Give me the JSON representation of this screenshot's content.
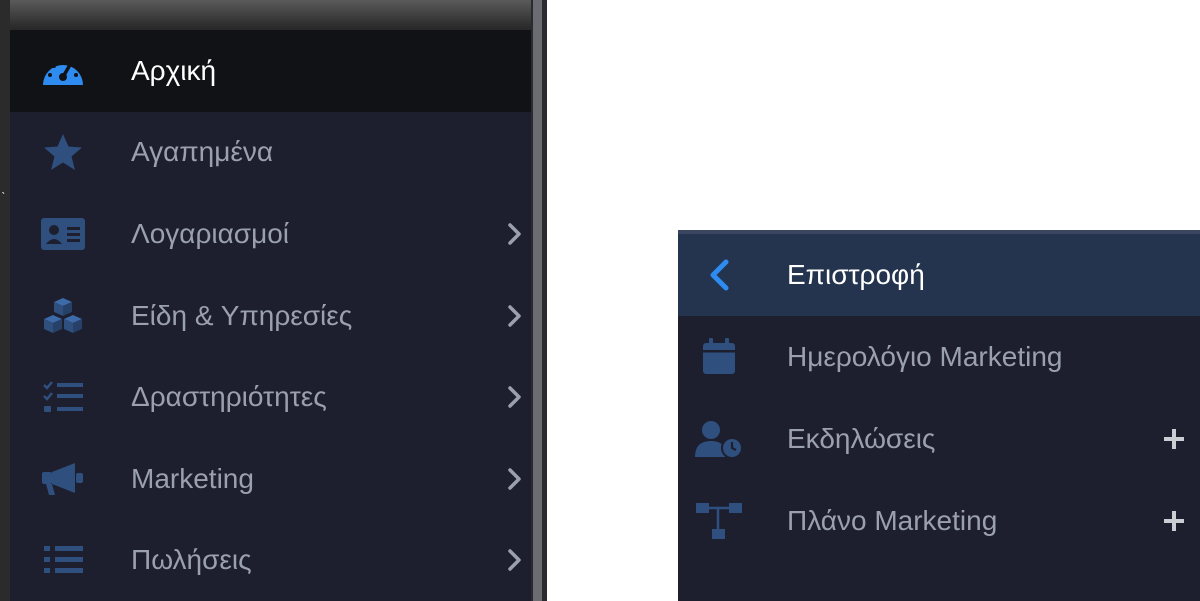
{
  "sidebar": {
    "items": [
      {
        "label": "Αρχική",
        "icon": "dashboard-gauge-icon",
        "active": true,
        "has_chevron": false
      },
      {
        "label": "Αγαπημένα",
        "icon": "star-icon",
        "active": false,
        "has_chevron": false
      },
      {
        "label": "Λογαριασμοί",
        "icon": "id-card-icon",
        "active": false,
        "has_chevron": true
      },
      {
        "label": "Είδη & Υπηρεσίες",
        "icon": "cubes-icon",
        "active": false,
        "has_chevron": true
      },
      {
        "label": "Δραστηριότητες",
        "icon": "checklist-icon",
        "active": false,
        "has_chevron": true
      },
      {
        "label": "Marketing",
        "icon": "megaphone-icon",
        "active": false,
        "has_chevron": true
      },
      {
        "label": "Πωλήσεις",
        "icon": "list-icon",
        "active": false,
        "has_chevron": true
      }
    ]
  },
  "submenu": {
    "back_label": "Επιστροφή",
    "items": [
      {
        "label": "Ημερολόγιο Marketing",
        "icon": "calendar-icon",
        "has_plus": false
      },
      {
        "label": "Εκδηλώσεις",
        "icon": "user-clock-icon",
        "has_plus": true
      },
      {
        "label": "Πλάνο Marketing",
        "icon": "sitemap-icon",
        "has_plus": true
      }
    ]
  },
  "colors": {
    "panel_bg": "#1d1e2e",
    "active_bg": "#111216",
    "back_bg": "#24344f",
    "accent_blue": "#2e8bf0",
    "icon_blue": "#2f4f7e",
    "text_muted": "#9aa1ad",
    "text_active": "#ffffff"
  }
}
